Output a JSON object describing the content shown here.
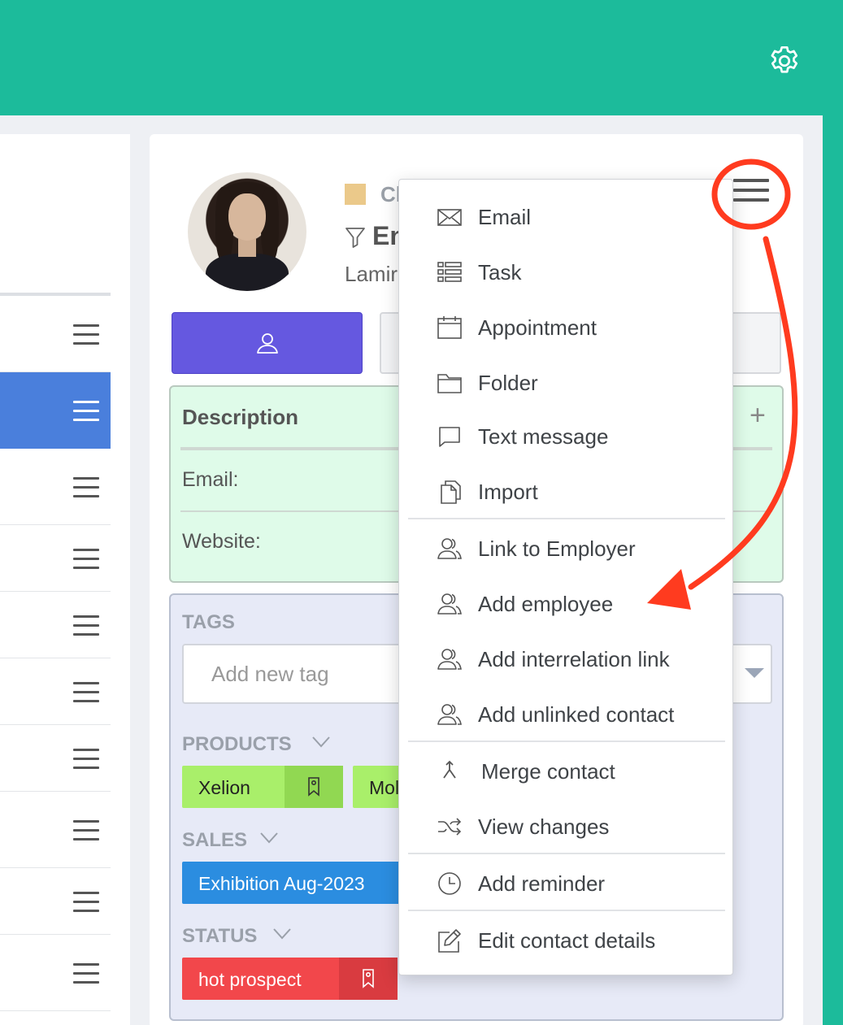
{
  "card": {
    "category_text": "Cl",
    "name_text": "En",
    "company_text": "Lamir"
  },
  "description": {
    "title": "Description",
    "plus": "+",
    "email_label": "Email:",
    "website_label": "Website:"
  },
  "tags": {
    "label": "TAGS",
    "input_placeholder": "Add new tag",
    "products_label": "PRODUCTS",
    "products": [
      "Xelion",
      "Mol"
    ],
    "sales_label": "SALES",
    "sales": [
      "Exhibition Aug-2023"
    ],
    "status_label": "STATUS",
    "status": [
      "hot prospect"
    ]
  },
  "menu": {
    "items": [
      {
        "label": "Email",
        "icon": "envelope-icon"
      },
      {
        "label": "Task",
        "icon": "task-list-icon"
      },
      {
        "label": "Appointment",
        "icon": "calendar-icon"
      },
      {
        "label": "Folder",
        "icon": "folder-icon"
      },
      {
        "label": "Text message",
        "icon": "chat-bubble-icon"
      },
      {
        "label": "Import",
        "icon": "documents-icon"
      },
      {
        "label": "Link to Employer",
        "icon": "users-icon"
      },
      {
        "label": "Add employee",
        "icon": "users-icon"
      },
      {
        "label": "Add interrelation link",
        "icon": "users-icon"
      },
      {
        "label": "Add unlinked contact",
        "icon": "users-icon"
      },
      {
        "label": "Merge contact",
        "icon": "merge-icon"
      },
      {
        "label": "View changes",
        "icon": "shuffle-icon"
      },
      {
        "label": "Add reminder",
        "icon": "clock-icon"
      },
      {
        "label": "Edit contact details",
        "icon": "edit-icon"
      }
    ]
  },
  "colors": {
    "header": "#1cbb9b",
    "accent_purple": "#6558e0",
    "active_row": "#4a7fdc",
    "annotation_red": "#ff3b1f"
  }
}
